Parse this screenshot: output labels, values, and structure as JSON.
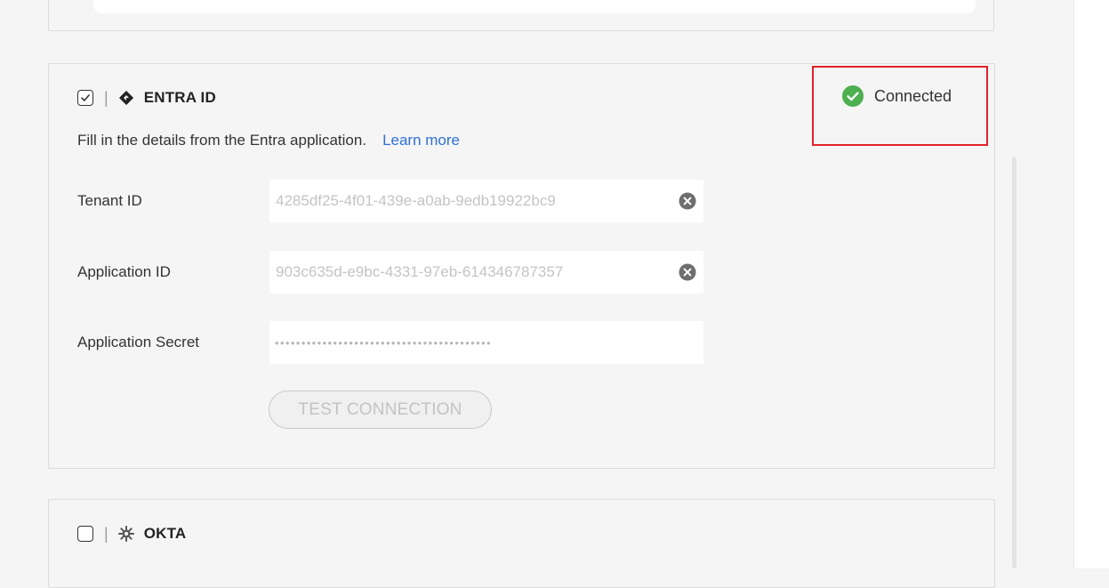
{
  "entra": {
    "provider_name": "ENTRA ID",
    "checked": true,
    "status": {
      "text": "Connected",
      "color": "#4caf50"
    },
    "description": "Fill in the details from the Entra application.",
    "learn_more": "Learn more",
    "fields": [
      {
        "label": "Tenant ID",
        "value": "4285df25-4f01-439e-a0ab-9edb19922bc9"
      },
      {
        "label": "Application ID",
        "value": "903c635d-e9bc-4331-97eb-614346787357"
      },
      {
        "label": "Application Secret",
        "value": "•••••••••••••••••••••••••••••••••••••••••"
      }
    ],
    "test_connection_label": "TEST CONNECTION"
  },
  "okta": {
    "provider_name": "OKTA",
    "checked": false
  },
  "colors": {
    "accent_link": "#2f6fd6",
    "highlight_border": "#e0242b",
    "success": "#4caf50"
  },
  "icons": {
    "checkbox": "check-icon",
    "entra": "entra-diamond-icon",
    "okta": "okta-sunburst-icon",
    "status": "check-circle-icon",
    "clear": "clear-x-circle-icon"
  }
}
